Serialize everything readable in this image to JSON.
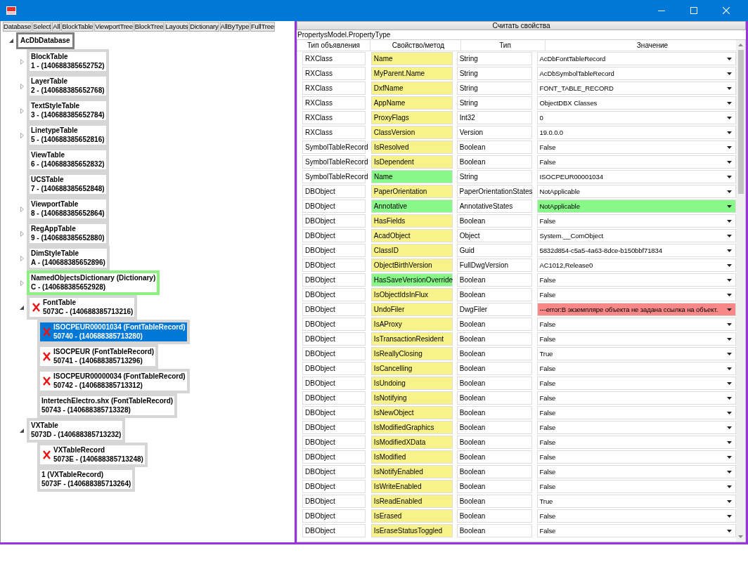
{
  "toolbar": [
    "Database",
    "Select",
    "All",
    "BlockTable",
    "ViewportTree",
    "BlockTree",
    "Layouts",
    "Dictionary",
    "AllByType",
    "FullTree"
  ],
  "tree": [
    {
      "title": "AcDbDatabase",
      "has_children": true,
      "expanded": true,
      "error": false,
      "selected": false,
      "highlight": false,
      "children": [
        {
          "title": "BlockTable",
          "id": "1 - (140688385652752)",
          "has_children": true,
          "expanded": false,
          "error": false,
          "selected": false,
          "highlight": false
        },
        {
          "title": "LayerTable",
          "id": "2 - (140688385652768)",
          "has_children": true,
          "expanded": false,
          "error": false,
          "selected": false,
          "highlight": false
        },
        {
          "title": "TextStyleTable",
          "id": "3 - (140688385652784)",
          "has_children": true,
          "expanded": false,
          "error": false,
          "selected": false,
          "highlight": false
        },
        {
          "title": "LinetypeTable",
          "id": "5 - (140688385652816)",
          "has_children": true,
          "expanded": false,
          "error": false,
          "selected": false,
          "highlight": false
        },
        {
          "title": "ViewTable",
          "id": "6 - (140688385652832)",
          "has_children": false,
          "error": false,
          "selected": false,
          "highlight": false
        },
        {
          "title": "UCSTable",
          "id": "7 - (140688385652848)",
          "has_children": false,
          "error": false,
          "selected": false,
          "highlight": false
        },
        {
          "title": "ViewportTable",
          "id": "8 - (140688385652864)",
          "has_children": true,
          "expanded": false,
          "error": false,
          "selected": false,
          "highlight": false
        },
        {
          "title": "RegAppTable",
          "id": "9 - (140688385652880)",
          "has_children": true,
          "expanded": false,
          "error": false,
          "selected": false,
          "highlight": false
        },
        {
          "title": "DimStyleTable",
          "id": "A - (140688385652896)",
          "has_children": true,
          "expanded": false,
          "error": false,
          "selected": false,
          "highlight": false
        },
        {
          "title": "NamedObjectsDictionary  (Dictionary)",
          "id": "C - (140688385652928)",
          "has_children": true,
          "expanded": false,
          "error": false,
          "selected": false,
          "highlight": true
        },
        {
          "title": "FontTable",
          "id": "5073C - (140688385713216)",
          "has_children": true,
          "expanded": true,
          "error": true,
          "selected": false,
          "highlight": false,
          "children": [
            {
              "title": "ISOCPEUR00001034  (FontTableRecord)",
              "id": "50740 - (140688385713280)",
              "has_children": false,
              "error": true,
              "selected": true,
              "highlight": false
            },
            {
              "title": "ISOCPEUR  (FontTableRecord)",
              "id": "50741 - (140688385713296)",
              "has_children": false,
              "error": true,
              "selected": false,
              "highlight": false
            },
            {
              "title": "ISOCPEUR00000034  (FontTableRecord)",
              "id": "50742 - (140688385713312)",
              "has_children": false,
              "error": true,
              "selected": false,
              "highlight": false
            },
            {
              "title": "IntertechElectro.shx  (FontTableRecord)",
              "id": "50743 - (140688385713328)",
              "has_children": false,
              "error": false,
              "selected": false,
              "highlight": false
            }
          ]
        },
        {
          "title": "VXTable",
          "id": "5073D - (140688385713232)",
          "has_children": true,
          "expanded": true,
          "error": false,
          "selected": false,
          "highlight": false,
          "children": [
            {
              "title": "VXTableRecord",
              "id": "5073E - (140688385713248)",
              "has_children": false,
              "error": true,
              "selected": false,
              "highlight": false
            },
            {
              "title": "1  (VXTableRecord)",
              "id": "5073F - (140688385713264)",
              "has_children": false,
              "error": false,
              "selected": false,
              "highlight": false
            }
          ]
        }
      ]
    }
  ],
  "read_button": "Считать свойства",
  "model_label": "PropertysModel.PropertyType",
  "columns": [
    "Тип объявления",
    "Свойство/метод",
    "Тип",
    "Значение"
  ],
  "rows": [
    {
      "decl": "RXClass",
      "prop": {
        "text": "Name",
        "color": "#f8f28a"
      },
      "type": "String",
      "value": {
        "text": "AcDbFontTableRecord",
        "color": "#ffffff"
      }
    },
    {
      "decl": "RXClass",
      "prop": {
        "text": "MyParent.Name",
        "color": "#f8f28a"
      },
      "type": "String",
      "value": {
        "text": "AcDbSymbolTableRecord",
        "color": "#ffffff"
      }
    },
    {
      "decl": "RXClass",
      "prop": {
        "text": "DxfName",
        "color": "#f8f28a"
      },
      "type": "String",
      "value": {
        "text": "FONT_TABLE_RECORD",
        "color": "#ffffff"
      }
    },
    {
      "decl": "RXClass",
      "prop": {
        "text": "AppName",
        "color": "#f8f28a"
      },
      "type": "String",
      "value": {
        "text": "ObjectDBX Classes",
        "color": "#ffffff"
      }
    },
    {
      "decl": "RXClass",
      "prop": {
        "text": "ProxyFlags",
        "color": "#f8f28a"
      },
      "type": "Int32",
      "value": {
        "text": "0",
        "color": "#ffffff"
      }
    },
    {
      "decl": "RXClass",
      "prop": {
        "text": "ClassVersion",
        "color": "#f8f28a"
      },
      "type": "Version",
      "value": {
        "text": "19.0.0.0",
        "color": "#ffffff"
      }
    },
    {
      "decl": "SymbolTableRecord",
      "prop": {
        "text": "IsResolved",
        "color": "#f8f28a"
      },
      "type": "Boolean",
      "value": {
        "text": "False",
        "color": "#ffffff"
      }
    },
    {
      "decl": "SymbolTableRecord",
      "prop": {
        "text": "IsDependent",
        "color": "#f8f28a"
      },
      "type": "Boolean",
      "value": {
        "text": "False",
        "color": "#ffffff"
      }
    },
    {
      "decl": "SymbolTableRecord",
      "prop": {
        "text": "Name",
        "color": "#88f888"
      },
      "type": "String",
      "value": {
        "text": "ISOCPEUR00001034",
        "color": "#ffffff"
      }
    },
    {
      "decl": "DBObject",
      "prop": {
        "text": "PaperOrientation",
        "color": "#f8f28a"
      },
      "type": "PaperOrientationStates",
      "value": {
        "text": "NotApplicable",
        "color": "#ffffff"
      }
    },
    {
      "decl": "DBObject",
      "prop": {
        "text": "Annotative",
        "color": "#88f888"
      },
      "type": "AnnotativeStates",
      "value": {
        "text": "NotApplicable",
        "color": "#88f888"
      }
    },
    {
      "decl": "DBObject",
      "prop": {
        "text": "HasFields",
        "color": "#f8f28a"
      },
      "type": "Boolean",
      "value": {
        "text": "False",
        "color": "#ffffff"
      }
    },
    {
      "decl": "DBObject",
      "prop": {
        "text": "AcadObject",
        "color": "#f8f28a"
      },
      "type": "Object",
      "value": {
        "text": "System.__ComObject",
        "color": "#ffffff"
      }
    },
    {
      "decl": "DBObject",
      "prop": {
        "text": "ClassID",
        "color": "#f8f28a"
      },
      "type": "Guid",
      "value": {
        "text": "5832d854-c5a5-4a63-8dce-b150bbf71834",
        "color": "#ffffff"
      }
    },
    {
      "decl": "DBObject",
      "prop": {
        "text": "ObjectBirthVersion",
        "color": "#f8f28a"
      },
      "type": "FullDwgVersion",
      "value": {
        "text": "AC1012,Release0",
        "color": "#ffffff"
      }
    },
    {
      "decl": "DBObject",
      "prop": {
        "text": "HasSaveVersionOverride",
        "color": "#88f888"
      },
      "type": "Boolean",
      "value": {
        "text": "False",
        "color": "#ffffff"
      }
    },
    {
      "decl": "DBObject",
      "prop": {
        "text": "IsObjectIdsInFlux",
        "color": "#f8f28a"
      },
      "type": "Boolean",
      "value": {
        "text": "False",
        "color": "#ffffff"
      }
    },
    {
      "decl": "DBObject",
      "prop": {
        "text": "UndoFiler",
        "color": "#f8f28a"
      },
      "type": "DwgFiler",
      "value": {
        "text": "---error:В экземпляре объекта не задана ссылка на объект.",
        "color": "#f88888"
      }
    },
    {
      "decl": "DBObject",
      "prop": {
        "text": "IsAProxy",
        "color": "#f8f28a"
      },
      "type": "Boolean",
      "value": {
        "text": "False",
        "color": "#ffffff"
      }
    },
    {
      "decl": "DBObject",
      "prop": {
        "text": "IsTransactionResident",
        "color": "#f8f28a"
      },
      "type": "Boolean",
      "value": {
        "text": "False",
        "color": "#ffffff"
      }
    },
    {
      "decl": "DBObject",
      "prop": {
        "text": "IsReallyClosing",
        "color": "#f8f28a"
      },
      "type": "Boolean",
      "value": {
        "text": "True",
        "color": "#ffffff"
      }
    },
    {
      "decl": "DBObject",
      "prop": {
        "text": "IsCancelling",
        "color": "#f8f28a"
      },
      "type": "Boolean",
      "value": {
        "text": "False",
        "color": "#ffffff"
      }
    },
    {
      "decl": "DBObject",
      "prop": {
        "text": "IsUndoing",
        "color": "#f8f28a"
      },
      "type": "Boolean",
      "value": {
        "text": "False",
        "color": "#ffffff"
      }
    },
    {
      "decl": "DBObject",
      "prop": {
        "text": "IsNotifying",
        "color": "#f8f28a"
      },
      "type": "Boolean",
      "value": {
        "text": "False",
        "color": "#ffffff"
      }
    },
    {
      "decl": "DBObject",
      "prop": {
        "text": "IsNewObject",
        "color": "#f8f28a"
      },
      "type": "Boolean",
      "value": {
        "text": "False",
        "color": "#ffffff"
      }
    },
    {
      "decl": "DBObject",
      "prop": {
        "text": "IsModifiedGraphics",
        "color": "#f8f28a"
      },
      "type": "Boolean",
      "value": {
        "text": "False",
        "color": "#ffffff"
      }
    },
    {
      "decl": "DBObject",
      "prop": {
        "text": "IsModifiedXData",
        "color": "#f8f28a"
      },
      "type": "Boolean",
      "value": {
        "text": "False",
        "color": "#ffffff"
      }
    },
    {
      "decl": "DBObject",
      "prop": {
        "text": "IsModified",
        "color": "#f8f28a"
      },
      "type": "Boolean",
      "value": {
        "text": "False",
        "color": "#ffffff"
      }
    },
    {
      "decl": "DBObject",
      "prop": {
        "text": "IsNotifyEnabled",
        "color": "#f8f28a"
      },
      "type": "Boolean",
      "value": {
        "text": "False",
        "color": "#ffffff"
      }
    },
    {
      "decl": "DBObject",
      "prop": {
        "text": "IsWriteEnabled",
        "color": "#f8f28a"
      },
      "type": "Boolean",
      "value": {
        "text": "False",
        "color": "#ffffff"
      }
    },
    {
      "decl": "DBObject",
      "prop": {
        "text": "IsReadEnabled",
        "color": "#f8f28a"
      },
      "type": "Boolean",
      "value": {
        "text": "True",
        "color": "#ffffff"
      }
    },
    {
      "decl": "DBObject",
      "prop": {
        "text": "IsErased",
        "color": "#f8f28a"
      },
      "type": "Boolean",
      "value": {
        "text": "False",
        "color": "#ffffff"
      }
    },
    {
      "decl": "DBObject",
      "prop": {
        "text": "IsEraseStatusToggled",
        "color": "#f8f28a"
      },
      "type": "Boolean",
      "value": {
        "text": "False",
        "color": "#ffffff"
      }
    }
  ]
}
